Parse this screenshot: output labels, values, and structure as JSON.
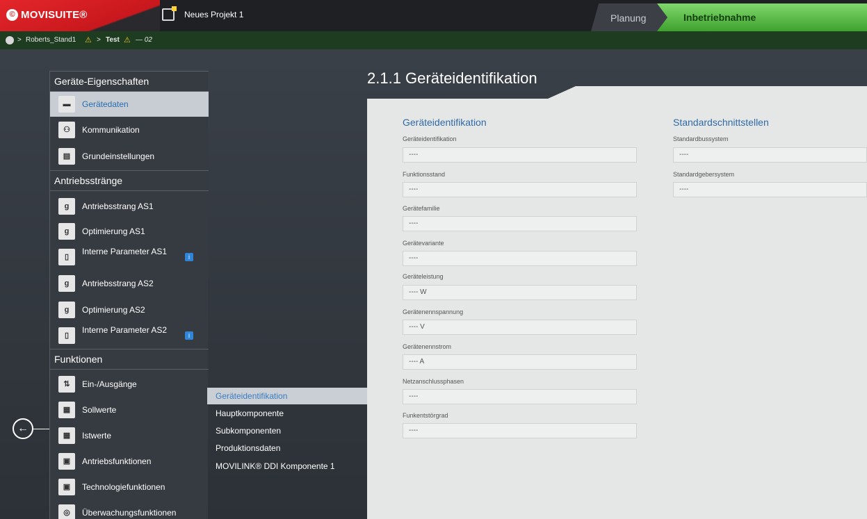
{
  "app": {
    "logo": "MOVISUITE®",
    "project": "Neues Projekt 1"
  },
  "tabs": {
    "planung": "Planung",
    "inbetriebnahme": "Inbetriebnahme"
  },
  "breadcrumb": {
    "node1": "Roberts_Stand1",
    "node2": "Test",
    "node3": "— 02"
  },
  "nav": {
    "section1": "Geräte-Eigenschaften",
    "geraetedaten": "Gerätedaten",
    "kommunikation": "Kommunikation",
    "grundeinstellungen": "Grundeinstellungen",
    "section2": "Antriebsstränge",
    "as1": "Antriebsstrang AS1",
    "opt1": "Optimierung AS1",
    "ip1": "Interne Parameter AS1",
    "as2": "Antriebsstrang AS2",
    "opt2": "Optimierung AS2",
    "ip2": "Interne Parameter AS2",
    "section3": "Funktionen",
    "io": "Ein-/Ausgänge",
    "sollwerte": "Sollwerte",
    "istwerte": "Istwerte",
    "antriebsfunktionen": "Antriebsfunktionen",
    "technologie": "Technologiefunktionen",
    "ueberwachung": "Überwachungsfunktionen"
  },
  "subnav": [
    "Geräteidentifikation",
    "Hauptkomponente",
    "Subkomponenten",
    "Produktionsdaten",
    "MOVILINK® DDI Komponente 1"
  ],
  "page": {
    "title": "2.1.1 Geräteidentifikation",
    "group1": "Geräteidentifikation",
    "group2": "Standardschnittstellen",
    "fields1": [
      {
        "label": "Geräteidentifikation",
        "value": "----"
      },
      {
        "label": "Funktionsstand",
        "value": "----"
      },
      {
        "label": "Gerätefamilie",
        "value": "----"
      },
      {
        "label": "Gerätevariante",
        "value": "----"
      },
      {
        "label": "Geräteleistung",
        "value": "---- W"
      },
      {
        "label": "Gerätenennspannung",
        "value": "---- V"
      },
      {
        "label": "Gerätenennstrom",
        "value": "---- A"
      },
      {
        "label": "Netzanschlussphasen",
        "value": "----"
      },
      {
        "label": "Funkentstörgrad",
        "value": "----"
      }
    ],
    "fields2": [
      {
        "label": "Standardbussystem",
        "value": "----"
      },
      {
        "label": "Standardgebersystem",
        "value": "----"
      }
    ]
  }
}
